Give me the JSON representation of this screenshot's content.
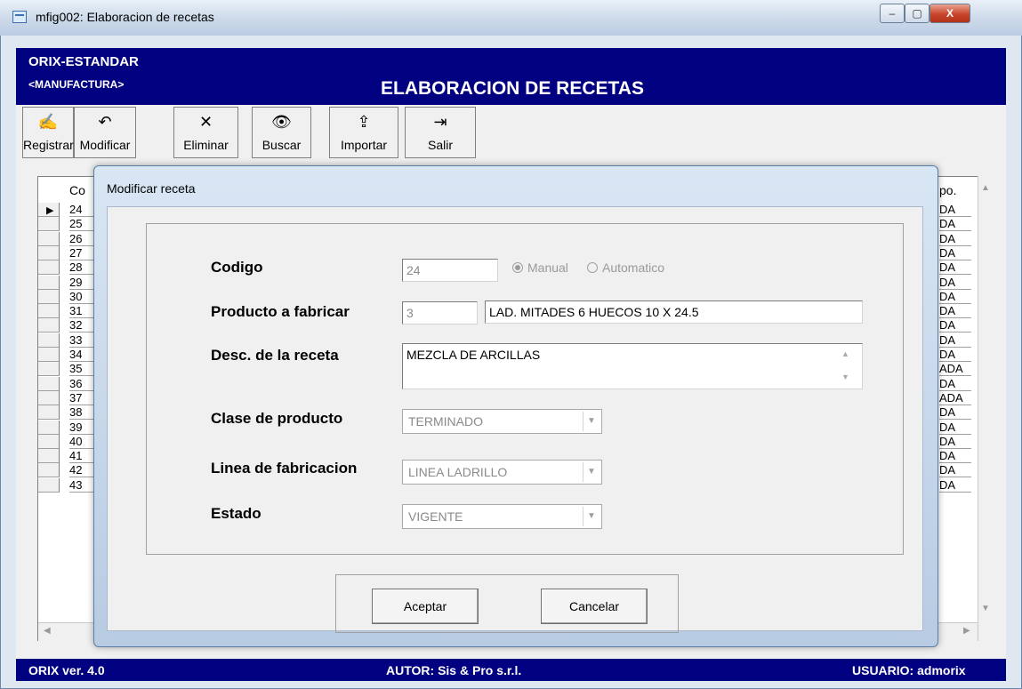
{
  "window": {
    "title": "mfig002: Elaboracion de recetas",
    "min": "–",
    "max": "▢",
    "close": "X"
  },
  "header": {
    "company": "ORIX-ESTANDAR",
    "module": "<MANUFACTURA>",
    "title": "ELABORACION DE RECETAS"
  },
  "toolbar": [
    {
      "label": "Registrar",
      "icon": "✍"
    },
    {
      "label": "Modificar",
      "icon": "↶"
    },
    {
      "label": "Eliminar",
      "icon": "✕"
    },
    {
      "label": "Buscar",
      "icon": "👁"
    },
    {
      "label": "Importar",
      "icon": "⇪"
    },
    {
      "label": "Salir",
      "icon": "⇥"
    }
  ],
  "grid": {
    "col_code": "Co",
    "col_right": "po.",
    "codes": [
      "24",
      "25",
      "26",
      "27",
      "28",
      "29",
      "30",
      "31",
      "32",
      "33",
      "34",
      "35",
      "36",
      "37",
      "38",
      "39",
      "40",
      "41",
      "42",
      "43"
    ],
    "right": [
      "DA",
      "DA",
      "DA",
      "DA",
      "DA",
      "DA",
      "DA",
      "DA",
      "DA",
      "DA",
      "DA",
      "ADA",
      "DA",
      "ADA",
      "DA",
      "DA",
      "DA",
      "DA",
      "DA",
      "DA"
    ]
  },
  "dialog": {
    "title": "Modificar receta",
    "labels": {
      "codigo": "Codigo",
      "producto": "Producto a fabricar",
      "desc": "Desc. de la receta",
      "clase": "Clase de producto",
      "linea": "Linea de fabricacion",
      "estado": "Estado"
    },
    "codigo": "24",
    "radio_manual": "Manual",
    "radio_auto": "Automatico",
    "producto_id": "3",
    "producto_name": "LAD. MITADES 6 HUECOS 10 X 24.5",
    "desc": "MEZCLA DE ARCILLAS",
    "clase": "TERMINADO",
    "linea": "LINEA LADRILLO",
    "estado": "VIGENTE",
    "accept": "Aceptar",
    "cancel": "Cancelar"
  },
  "status": {
    "version": "ORIX ver. 4.0",
    "author": "AUTOR: Sis & Pro s.r.l.",
    "user": "USUARIO: admorix"
  }
}
